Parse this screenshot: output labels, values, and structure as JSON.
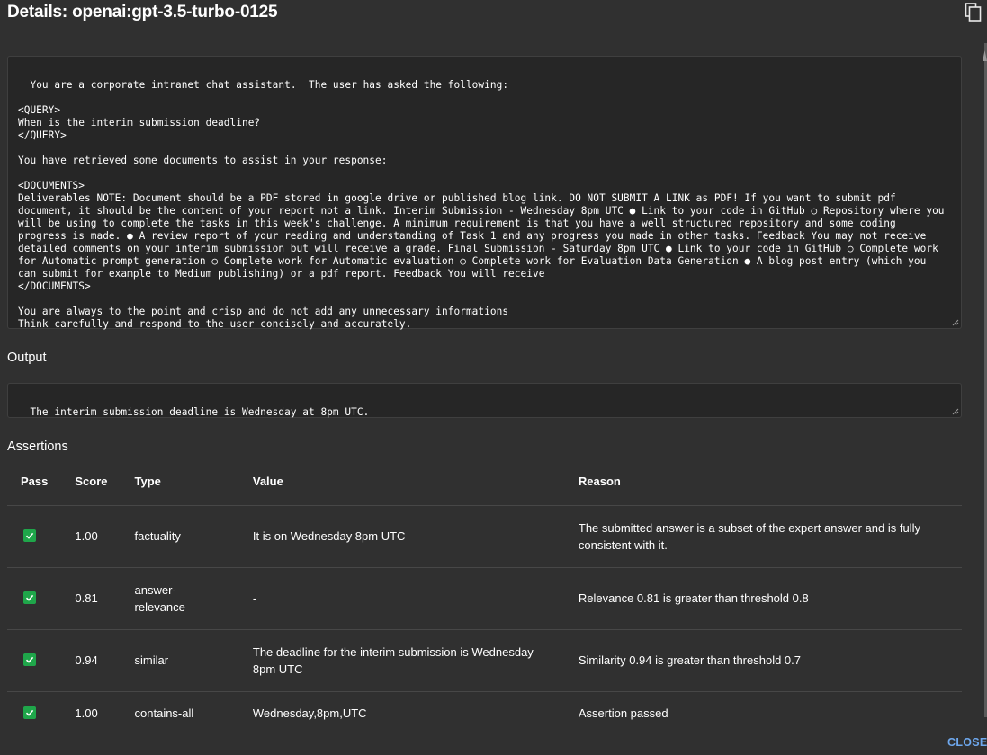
{
  "dialog": {
    "title": "Details: openai:gpt-3.5-turbo-0125",
    "close_label": "CLOSE"
  },
  "prompt": {
    "text": "You are a corporate intranet chat assistant.  The user has asked the following:\n\n<QUERY>\nWhen is the interim submission deadline?\n</QUERY>\n\nYou have retrieved some documents to assist in your response:\n\n<DOCUMENTS>\nDeliverables NOTE: Document should be a PDF stored in google drive or published blog link. DO NOT SUBMIT A LINK as PDF! If you want to submit pdf document, it should be the content of your report not a link. Interim Submission - Wednesday 8pm UTC ● Link to your code in GitHub ○ Repository where you will be using to complete the tasks in this week's challenge. A minimum requirement is that you have a well structured repository and some coding progress is made. ● A review report of your reading and understanding of Task 1 and any progress you made in other tasks. Feedback You may not receive detailed comments on your interim submission but will receive a grade. Final Submission - Saturday 8pm UTC ● Link to your code in GitHub ○ Complete work for Automatic prompt generation ○ Complete work for Automatic evaluation ○ Complete work for Evaluation Data Generation ● A blog post entry (which you can submit for example to Medium publishing) or a pdf report. Feedback You will receive\n</DOCUMENTS>\n\nYou are always to the point and crisp and do not add any unnecessary informations\nThink carefully and respond to the user concisely and accurately."
  },
  "output": {
    "heading": "Output",
    "text": "The interim submission deadline is Wednesday at 8pm UTC."
  },
  "assertions": {
    "heading": "Assertions",
    "columns": {
      "pass": "Pass",
      "score": "Score",
      "type": "Type",
      "value": "Value",
      "reason": "Reason"
    },
    "rows": [
      {
        "pass": true,
        "score": "1.00",
        "type": "factuality",
        "value": "It is on Wednesday 8pm UTC",
        "reason": "The submitted answer is a subset of the expert answer and is fully consistent with it."
      },
      {
        "pass": true,
        "score": "0.81",
        "type": "answer-relevance",
        "value": "-",
        "reason": "Relevance 0.81 is greater than threshold 0.8"
      },
      {
        "pass": true,
        "score": "0.94",
        "type": "similar",
        "value": "The deadline for the interim submission is Wednesday 8pm UTC",
        "reason": "Similarity 0.94 is greater than threshold 0.7"
      },
      {
        "pass": true,
        "score": "1.00",
        "type": "contains-all",
        "value": "Wednesday,8pm,UTC",
        "reason": "Assertion passed"
      }
    ]
  },
  "colors": {
    "background": "#303030",
    "textbox": "#262626",
    "check": "#1fa64a",
    "close": "#6ea8ee"
  }
}
